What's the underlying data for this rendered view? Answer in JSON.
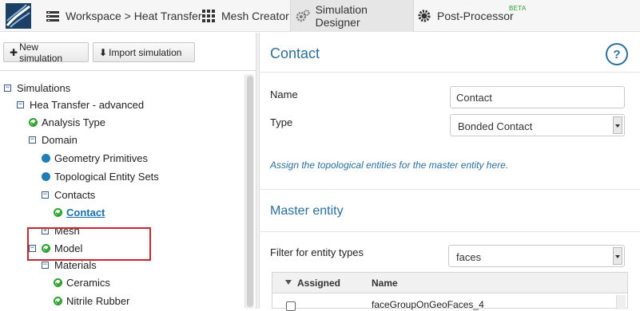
{
  "nav": {
    "tabs": [
      {
        "label": "Workspace > Heat Transfer",
        "icon": "workspace-icon"
      },
      {
        "label": "Mesh Creator",
        "icon": "grid-icon"
      },
      {
        "label": "Simulation Designer",
        "icon": "gears-icon",
        "active": true
      },
      {
        "label": "Post-Processor",
        "icon": "gear-icon",
        "badge": "BETA"
      }
    ]
  },
  "toolbar": {
    "new_simulation": "New simulation",
    "import_simulation": "Import simulation"
  },
  "tree": {
    "root": "Simulations",
    "sim": "Hea Transfer - advanced",
    "analysis_type": "Analysis Type",
    "domain": "Domain",
    "geometry_primitives": "Geometry Primitives",
    "topological_entity_sets": "Topological Entity Sets",
    "contacts": "Contacts",
    "contact": "Contact",
    "mesh": "Mesh",
    "model": "Model",
    "materials": "Materials",
    "ceramics": "Ceramics",
    "nitrile_rubber": "Nitrile Rubber"
  },
  "panel": {
    "title": "Contact",
    "help": "?",
    "name_label": "Name",
    "name_value": "Contact",
    "type_label": "Type",
    "type_value": "Bonded Contact",
    "hint": "Assign the topological entities for the master entity here.",
    "master_entity": "Master entity",
    "filter_label": "Filter for entity types",
    "filter_value": "faces",
    "grid": {
      "col_assigned": "Assigned",
      "col_name": "Name",
      "row1_name": "faceGroupOnGeoFaces_4"
    }
  },
  "colors": {
    "accent": "#2a6f9e",
    "highlight_border": "#c9252b",
    "check_green": "#2ca02c",
    "beta_green": "#2a9d2a"
  }
}
